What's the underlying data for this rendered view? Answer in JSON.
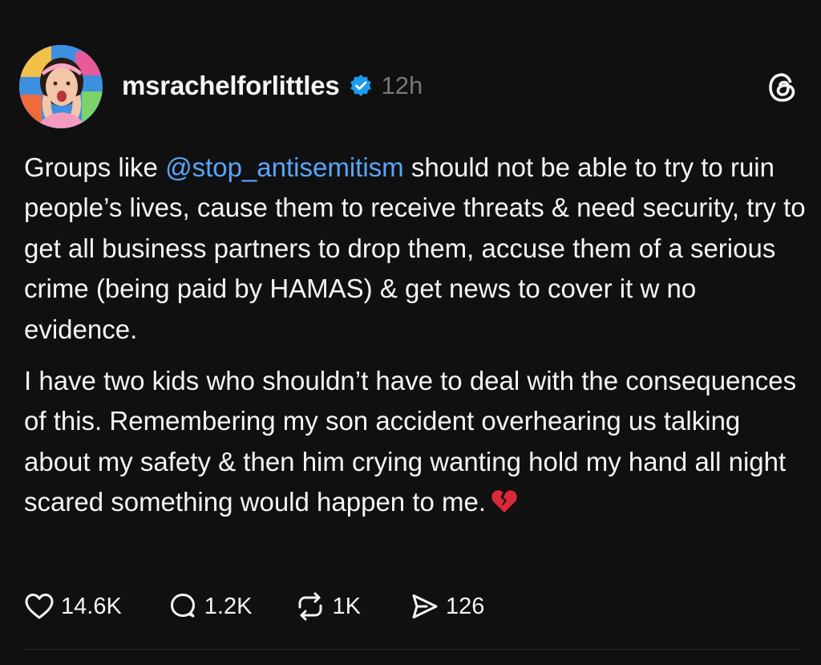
{
  "post": {
    "author": {
      "username": "msrachelforlittles",
      "verified": true,
      "avatar_icon": "profile-photo",
      "accent_color": "#58a6ff"
    },
    "timestamp": "12h",
    "app_icon": "threads-logo-icon",
    "paragraphs": [
      {
        "before": "Groups like ",
        "mention": "@stop_antisemitism",
        "after": " should not be able to try to ruin people’s lives, cause them to receive threats & need security, try to get all business partners to drop them, accuse them of a serious crime (being paid by HAMAS) & get news to cover it w no evidence."
      },
      {
        "text": "I have two kids who shouldn’t have to deal with the consequences of this. Remembering my son accident overhearing us talking about my safety & then him crying wanting hold my hand all night scared something would happen to me.",
        "emoji": "broken-heart"
      }
    ],
    "stats": {
      "likes": "14.6K",
      "replies": "1.2K",
      "reposts": "1K",
      "shares": "126"
    }
  }
}
